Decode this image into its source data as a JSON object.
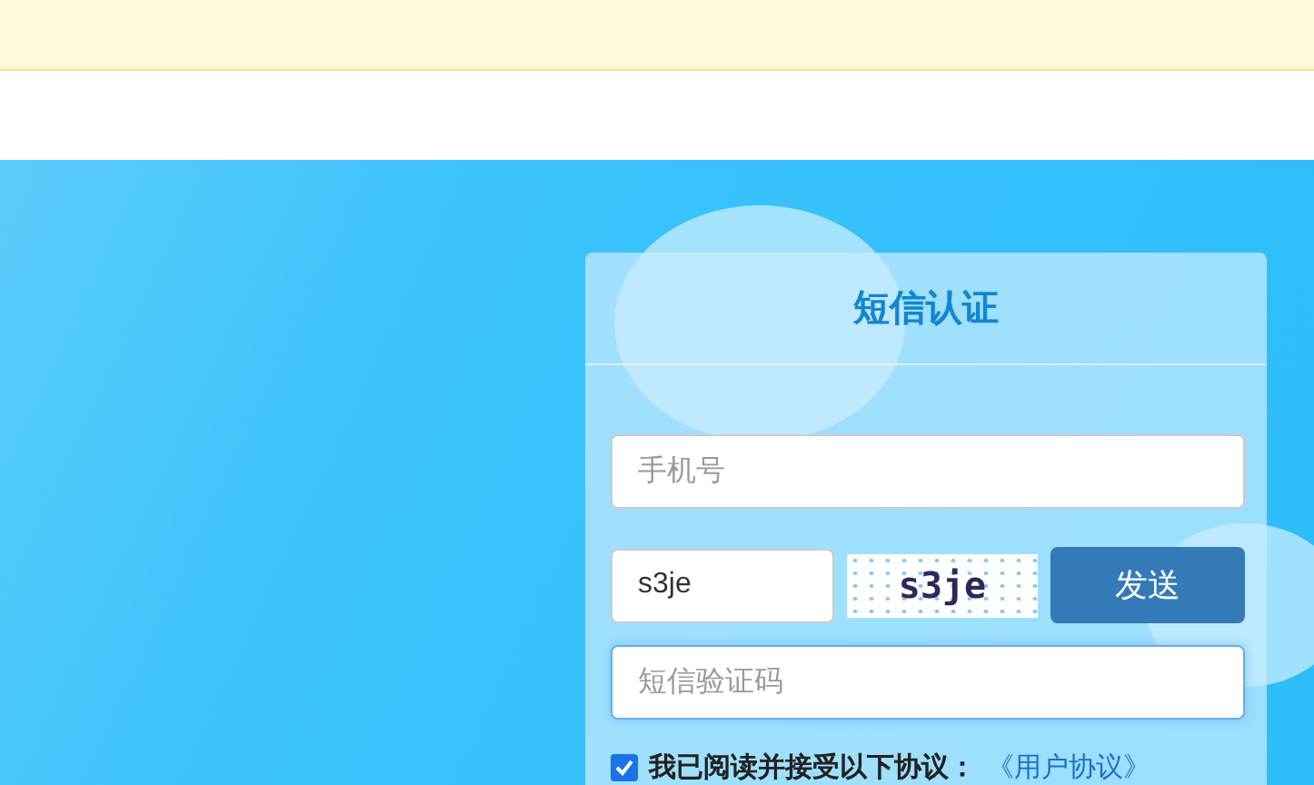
{
  "card": {
    "title": "短信认证",
    "phone": {
      "placeholder": "手机号"
    },
    "captcha": {
      "value": "s3je",
      "image_text": "s3je"
    },
    "send_button": "发送",
    "sms_code": {
      "placeholder": "短信验证码",
      "focused": true
    },
    "agreement": {
      "checked": true,
      "text": "我已阅读并接受以下协议：",
      "link": "《用户协议》"
    }
  }
}
